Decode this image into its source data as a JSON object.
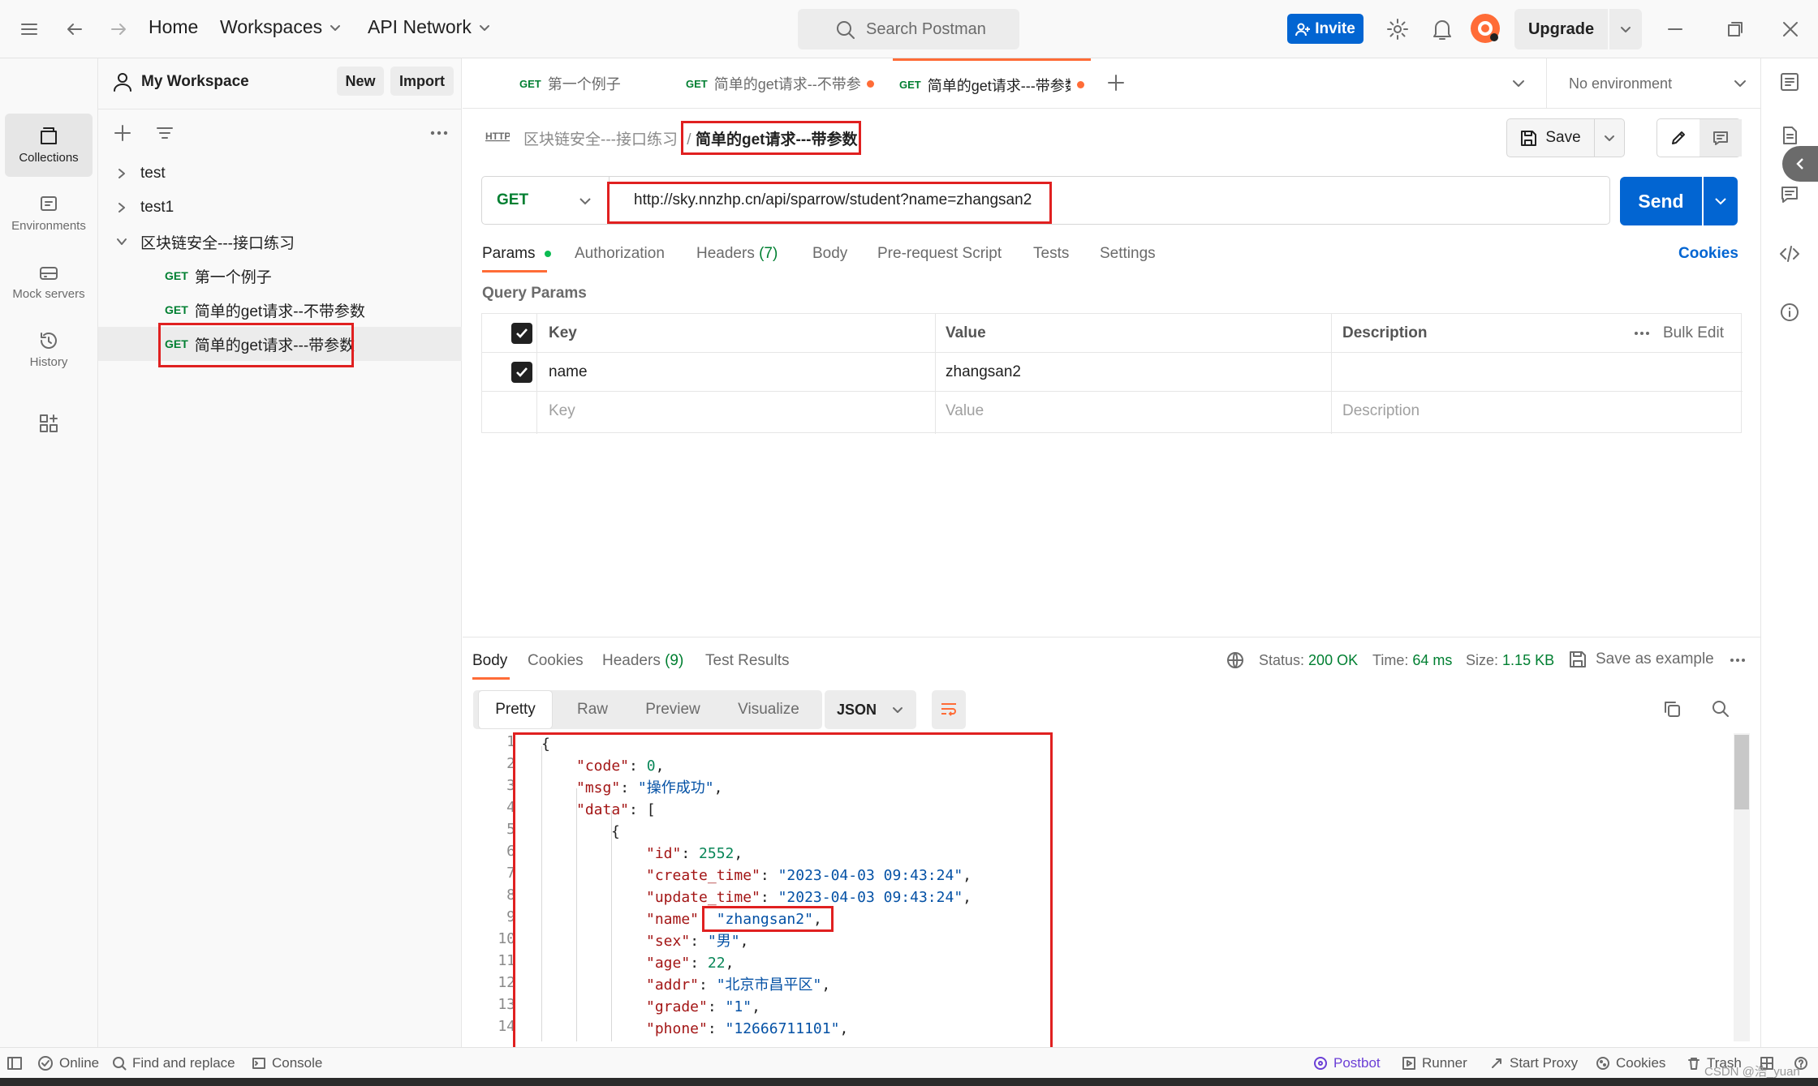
{
  "topbar": {
    "home": "Home",
    "workspaces": "Workspaces",
    "api_network": "API Network",
    "search_placeholder": "Search Postman",
    "invite": "Invite",
    "upgrade": "Upgrade"
  },
  "rail": {
    "items": [
      {
        "label": "Collections",
        "icon": "collections-icon",
        "active": true
      },
      {
        "label": "Environments",
        "icon": "environments-icon"
      },
      {
        "label": "Mock servers",
        "icon": "mock-servers-icon"
      },
      {
        "label": "History",
        "icon": "history-icon"
      }
    ]
  },
  "sidebar": {
    "workspace_name": "My Workspace",
    "new_label": "New",
    "import_label": "Import",
    "tree": [
      {
        "label": "test",
        "type": "collection"
      },
      {
        "label": "test1",
        "type": "collection"
      },
      {
        "label": "区块链安全---接口练习",
        "type": "collection",
        "expanded": true
      },
      {
        "method": "GET",
        "label": "第一个例子",
        "type": "request"
      },
      {
        "method": "GET",
        "label": "简单的get请求--不带参数",
        "type": "request"
      },
      {
        "method": "GET",
        "label": "简单的get请求---带参数",
        "type": "request",
        "selected": true
      }
    ]
  },
  "tabs": [
    {
      "method": "GET",
      "label": "第一个例子",
      "unsaved": false
    },
    {
      "method": "GET",
      "label": "简单的get请求--不带参",
      "unsaved": true
    },
    {
      "method": "GET",
      "label": "简单的get请求---带参数",
      "unsaved": true,
      "active": true
    }
  ],
  "environment": "No environment",
  "breadcrumb": {
    "collection": "区块链安全---接口练习",
    "separator": "/",
    "request": "简单的get请求---带参数"
  },
  "actions": {
    "save": "Save"
  },
  "request": {
    "method": "GET",
    "url": "http://sky.nnzhp.cn/api/sparrow/student?name=zhangsan2",
    "send": "Send"
  },
  "request_tabs": {
    "params": "Params",
    "authorization": "Authorization",
    "headers": "Headers",
    "headers_count": "(7)",
    "body": "Body",
    "prerequest": "Pre-request Script",
    "tests": "Tests",
    "settings": "Settings",
    "cookies": "Cookies"
  },
  "query_params": {
    "title": "Query Params",
    "headers": {
      "key": "Key",
      "value": "Value",
      "description": "Description",
      "bulk_edit": "Bulk Edit"
    },
    "rows": [
      {
        "checked": true,
        "key": "name",
        "value": "zhangsan2",
        "description": ""
      }
    ],
    "placeholders": {
      "key": "Key",
      "value": "Value",
      "description": "Description"
    }
  },
  "response": {
    "tabs": {
      "body": "Body",
      "cookies": "Cookies",
      "headers": "Headers",
      "headers_count": "(9)",
      "test_results": "Test Results"
    },
    "status_label": "Status:",
    "status_value": "200 OK",
    "time_label": "Time:",
    "time_value": "64 ms",
    "size_label": "Size:",
    "size_value": "1.15 KB",
    "save_example": "Save as example",
    "views": {
      "pretty": "Pretty",
      "raw": "Raw",
      "preview": "Preview",
      "visualize": "Visualize"
    },
    "format": "JSON",
    "line_numbers": [
      "1",
      "2",
      "3",
      "4",
      "5",
      "6",
      "7",
      "8",
      "9",
      "10",
      "11",
      "12",
      "13",
      "14"
    ],
    "code": {
      "open_brace": "{",
      "code_key": "\"code\"",
      "code_val": "0",
      "msg_key": "\"msg\"",
      "msg_val": "\"操作成功\"",
      "data_key": "\"data\"",
      "data_open": "[",
      "obj_open": "{",
      "id_key": "\"id\"",
      "id_val": "2552",
      "create_key": "\"create_time\"",
      "create_val": "\"2023-04-03 09:43:24\"",
      "update_key": "\"update_time\"",
      "update_val": "\"2023-04-03 09:43:24\"",
      "name_key": "\"name\"",
      "name_val": "\"zhangsan2\"",
      "sex_key": "\"sex\"",
      "sex_val": "\"男\"",
      "age_key": "\"age\"",
      "age_val": "22",
      "addr_key": "\"addr\"",
      "addr_val": "\"北京市昌平区\"",
      "grade_key": "\"grade\"",
      "grade_val": "\"1\"",
      "phone_key": "\"phone\"",
      "phone_val": "\"12666711101\""
    }
  },
  "statusbar": {
    "online": "Online",
    "find_replace": "Find and replace",
    "console": "Console",
    "postbot": "Postbot",
    "runner": "Runner",
    "start_proxy": "Start Proxy",
    "cookies": "Cookies",
    "trash": "Trash",
    "watermark": "CSDN @浩_yuan"
  },
  "colors": {
    "accent": "#0265d2",
    "get": "#007f31",
    "brand": "#ff6c37",
    "highlight": "#e02020"
  }
}
